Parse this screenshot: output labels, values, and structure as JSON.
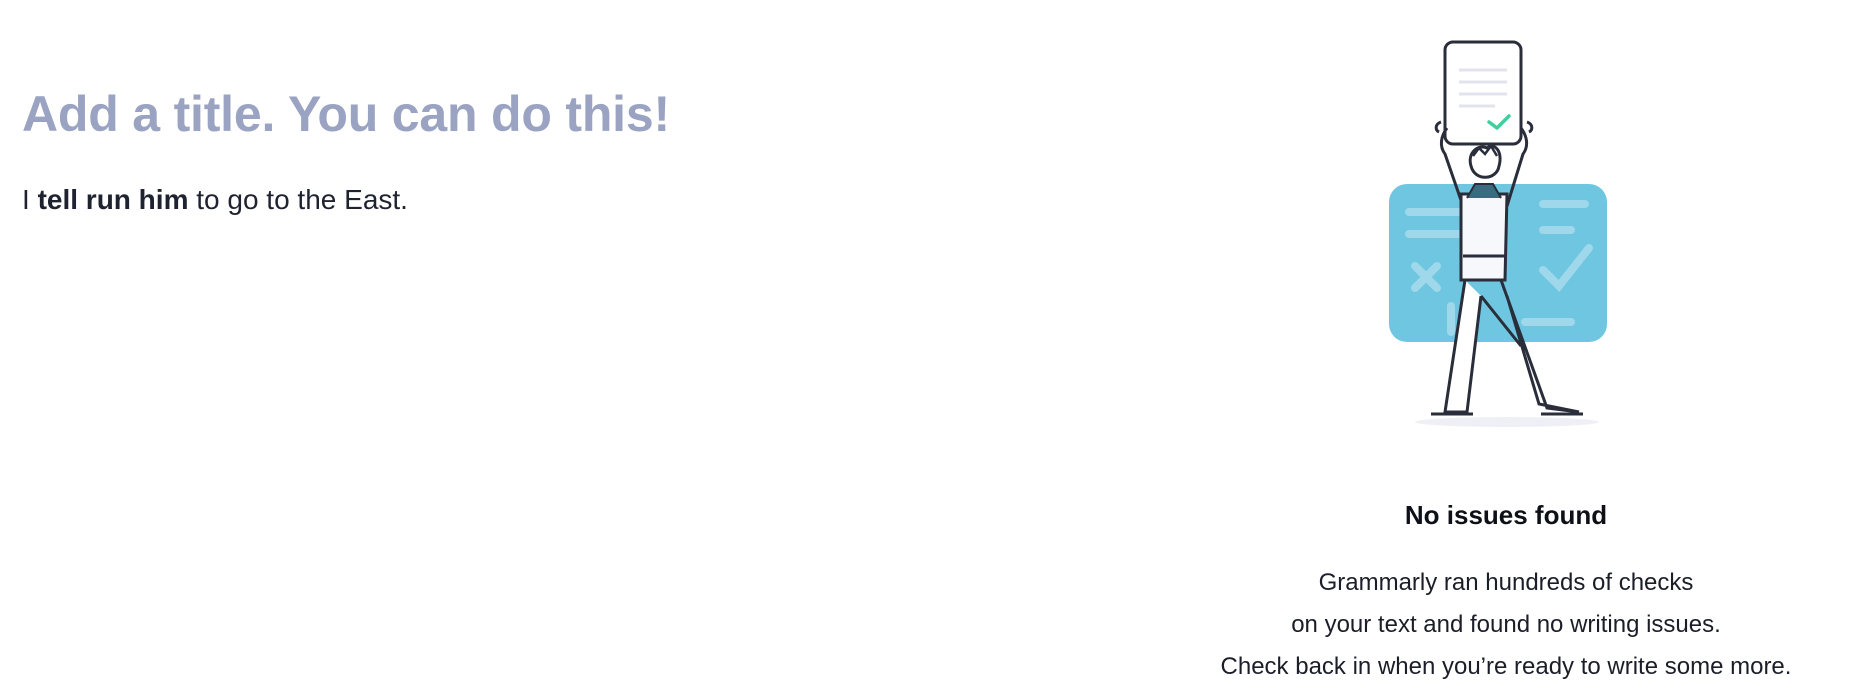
{
  "editor": {
    "title": "Add a title. You can do this!",
    "body": {
      "prefix": "I ",
      "bold": "tell run him",
      "suffix": " to go to the East."
    }
  },
  "assistant": {
    "illustration_icon": "person-holding-checked-document-illustration",
    "status_title": "No issues found",
    "status_lines": [
      "Grammarly ran hundreds of checks",
      "on your text and found no writing issues.",
      "Check back in when you’re ready to write some more."
    ]
  },
  "colors": {
    "title": "#9aa3c2",
    "card": "#6fc6e0",
    "check": "#3fcf9b"
  }
}
